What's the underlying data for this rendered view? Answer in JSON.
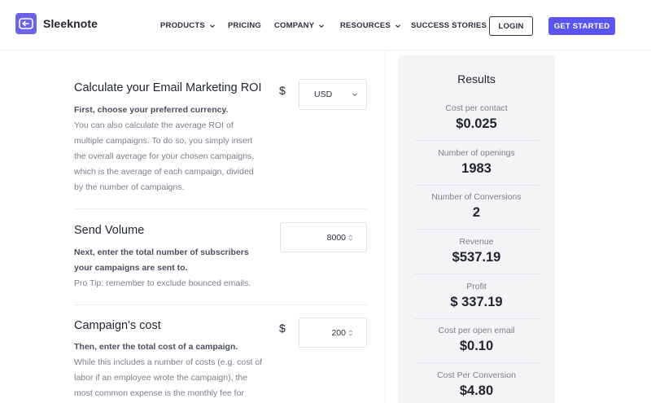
{
  "header": {
    "brand": "Sleeknote",
    "nav": [
      {
        "label": "PRODUCTS",
        "has_dropdown": true
      },
      {
        "label": "PRICING",
        "has_dropdown": false
      },
      {
        "label": "COMPANY",
        "has_dropdown": true
      },
      {
        "label": "RESOURCES",
        "has_dropdown": true
      },
      {
        "label": "SUCCESS STORIES",
        "has_dropdown": false
      }
    ],
    "login_label": "LOGIN",
    "cta_label": "GET STARTED",
    "cta_color": "#5a55ee",
    "brand_color": "#6d63e8"
  },
  "calculator": {
    "roi": {
      "title": "Calculate your Email Marketing ROI",
      "lead": "First, choose your preferred currency.",
      "lines": [
        "You can also calculate the average ROI of",
        "multiple campaigns. To do so, you simply insert",
        "the overall average for your chosen campaigns,",
        "which is the average of each campaign, divided",
        "by the number of campaigns."
      ],
      "currency_symbol": "$",
      "currency_value": "USD"
    },
    "volume": {
      "title": "Send Volume",
      "lead_lines": [
        "Next, enter the total number of subscribers",
        "your campaigns are sent to."
      ],
      "tip": "Pro Tip: remember to exclude bounced emails.",
      "value": "8000"
    },
    "cost": {
      "title": "Campaign's cost",
      "currency_symbol": "$",
      "lead": "Then, enter the total cost of a campaign.",
      "lines": [
        "While this includes a number of costs (e.g. cost of",
        "labor if an employee wrote the campaign), the",
        "most common expense is the monthly fee for"
      ],
      "value": "200"
    }
  },
  "results": {
    "title": "Results",
    "items": [
      {
        "label": "Cost per contact",
        "value": "$0.025"
      },
      {
        "label": "Number of openings",
        "value": "1983"
      },
      {
        "label": "Number of Conversions",
        "value": "2"
      },
      {
        "label": "Revenue",
        "value": "$537.19"
      },
      {
        "label": "Profit",
        "value": "$ 337.19"
      },
      {
        "label": "Cost per open email",
        "value": "$0.10"
      },
      {
        "label": "Cost Per Conversion",
        "value": "$4.80"
      }
    ]
  }
}
